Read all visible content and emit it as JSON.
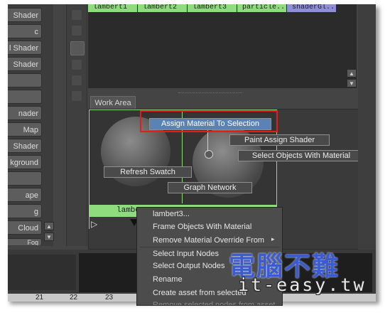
{
  "left_panel": {
    "buttons": [
      " Shader",
      "c",
      "l Shader",
      "Shader",
      "",
      "",
      "",
      "nader",
      "Map",
      "Shader",
      "kground",
      "",
      "ape",
      "g",
      "Cloud"
    ],
    "partial_bottom": "Fog"
  },
  "material_tabs": [
    "lambert1",
    "lambert2",
    "lambert3",
    "particle...",
    "shaderGl..."
  ],
  "work_area": {
    "tab_label": "Work Area",
    "node_label": "lambe"
  },
  "marking_menu": {
    "assign": "Assign Material To Selection",
    "paint_assign": "Paint Assign Shader",
    "select_objects": "Select Objects With Material",
    "refresh": "Refresh Swatch",
    "graph_network": "Graph Network"
  },
  "context_menu": {
    "items": [
      "lambert3...",
      "Frame Objects With Material",
      "Remove Material Override From",
      "Select Input Nodes",
      "Select Output Nodes",
      "Rename",
      "Create asset from selected",
      "Remove selected nodes from asset"
    ],
    "submenu_arrow": "▸"
  },
  "timeline": {
    "ticks": [
      "21",
      "22",
      "23"
    ]
  },
  "watermark": {
    "title": "電腦不難",
    "subtitle": "it-easy.tw"
  },
  "colors": {
    "highlight_outline": "#e21d1d",
    "menu_selected": "#5a82b4",
    "tab_green": "#8fdc7e",
    "tab_purple": "#8f8fd9"
  }
}
